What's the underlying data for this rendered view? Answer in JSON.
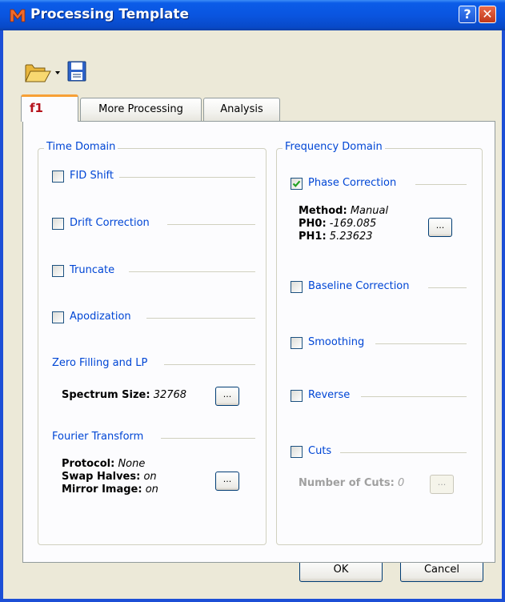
{
  "window": {
    "title": "Processing Template",
    "app_icon": "m-logo-icon",
    "help_label": "?",
    "close_label": "✕"
  },
  "toolbar": {
    "open_icon": "folder-open-icon",
    "dropdown_icon": "dropdown-arrow-icon",
    "save_icon": "save-disk-icon"
  },
  "tabs": [
    {
      "label": "f1",
      "active": true
    },
    {
      "label": "More Processing"
    },
    {
      "label": "Analysis"
    }
  ],
  "time_domain": {
    "title": "Time Domain",
    "fid_shift": {
      "label": "FID Shift",
      "checked": false
    },
    "drift_correction": {
      "label": "Drift Correction",
      "checked": false
    },
    "truncate": {
      "label": "Truncate",
      "checked": false
    },
    "apodization": {
      "label": "Apodization",
      "checked": false
    },
    "zero_filling": {
      "heading": "Zero Filling and LP",
      "spectrum_size_label": "Spectrum Size:",
      "spectrum_size_value": "32768",
      "button_label": "..."
    },
    "fourier": {
      "heading": "Fourier Transform",
      "protocol_label": "Protocol:",
      "protocol_value": "None",
      "swap_label": "Swap Halves:",
      "swap_value": "on",
      "mirror_label": "Mirror Image:",
      "mirror_value": "on",
      "button_label": "..."
    }
  },
  "frequency_domain": {
    "title": "Frequency Domain",
    "phase_correction": {
      "label": "Phase Correction",
      "checked": true,
      "method_label": "Method:",
      "method_value": "Manual",
      "ph0_label": "PH0:",
      "ph0_value": "-169.085",
      "ph1_label": "PH1:",
      "ph1_value": "5.23623",
      "button_label": "..."
    },
    "baseline_correction": {
      "label": "Baseline Correction",
      "checked": false
    },
    "smoothing": {
      "label": "Smoothing",
      "checked": false
    },
    "reverse": {
      "label": "Reverse",
      "checked": false
    },
    "cuts": {
      "label": "Cuts",
      "checked": false,
      "number_label": "Number of Cuts:",
      "number_value": "0",
      "button_label": "..."
    }
  },
  "footer": {
    "ok_label": "OK",
    "cancel_label": "Cancel"
  },
  "colors": {
    "titlebar": "#0a55e0",
    "window_bg": "#ece9d8",
    "group_title": "#0046d5",
    "active_tab_accent": "#f7a035",
    "active_tab_text": "#b5121b"
  }
}
